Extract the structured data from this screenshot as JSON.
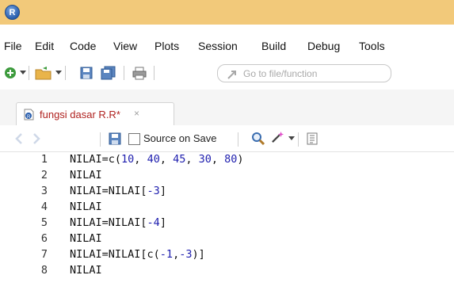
{
  "titlebar": {
    "logo_letter": "R"
  },
  "menu": {
    "items": [
      "File",
      "Edit",
      "Code",
      "View",
      "Plots",
      "Session",
      "Build",
      "Debug",
      "Tools"
    ]
  },
  "toolbar": {
    "goto_placeholder": "Go to file/function"
  },
  "tab": {
    "label": "fungsi dasar R.R*",
    "close": "×"
  },
  "editor_toolbar": {
    "source_on_save_label": "Source on Save"
  },
  "editor": {
    "line_numbers": [
      "1",
      "2",
      "3",
      "4",
      "5",
      "6",
      "7",
      "8"
    ],
    "lines": [
      [
        {
          "t": "NILAI=c(",
          "c": "code"
        },
        {
          "t": "10",
          "c": "num"
        },
        {
          "t": ", ",
          "c": "code"
        },
        {
          "t": "40",
          "c": "num"
        },
        {
          "t": ", ",
          "c": "code"
        },
        {
          "t": "45",
          "c": "num"
        },
        {
          "t": ", ",
          "c": "code"
        },
        {
          "t": "30",
          "c": "num"
        },
        {
          "t": ", ",
          "c": "code"
        },
        {
          "t": "80",
          "c": "num"
        },
        {
          "t": ")",
          "c": "code"
        }
      ],
      [
        {
          "t": "NILAI",
          "c": "code"
        }
      ],
      [
        {
          "t": "NILAI=NILAI[",
          "c": "code"
        },
        {
          "t": "-3",
          "c": "num"
        },
        {
          "t": "]",
          "c": "code"
        }
      ],
      [
        {
          "t": "NILAI",
          "c": "code"
        }
      ],
      [
        {
          "t": "NILAI=NILAI[",
          "c": "code"
        },
        {
          "t": "-4",
          "c": "num"
        },
        {
          "t": "]",
          "c": "code"
        }
      ],
      [
        {
          "t": "NILAI",
          "c": "code"
        }
      ],
      [
        {
          "t": "NILAI=NILAI[c(",
          "c": "code"
        },
        {
          "t": "-1",
          "c": "num"
        },
        {
          "t": ",",
          "c": "code"
        },
        {
          "t": "-3",
          "c": "num"
        },
        {
          "t": ")]",
          "c": "code"
        }
      ],
      [
        {
          "t": "NILAI",
          "c": "code"
        }
      ]
    ]
  },
  "colors": {
    "titlebar": "#f2c97a",
    "tab_label": "#b0221f",
    "number": "#1e1eae"
  }
}
